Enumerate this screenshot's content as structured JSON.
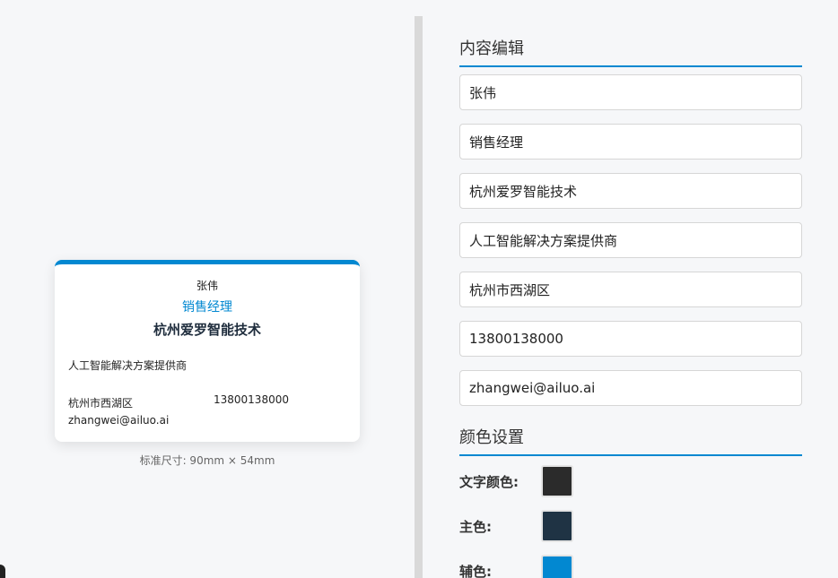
{
  "card": {
    "name": "张伟",
    "title": "销售经理",
    "company": "杭州爱罗智能技术",
    "slogan": "人工智能解决方案提供商",
    "address": "杭州市西湖区",
    "phone": "13800138000",
    "email": "zhangwei@ailuo.ai",
    "accent_color": "#0288d1"
  },
  "preview": {
    "size_note": "标准尺寸: 90mm × 54mm"
  },
  "editor": {
    "content_heading": "内容编辑",
    "fields": {
      "name": "张伟",
      "title": "销售经理",
      "company": "杭州爱罗智能技术",
      "slogan": "人工智能解决方案提供商",
      "address": "杭州市西湖区",
      "phone": "13800138000",
      "email": "zhangwei@ailuo.ai"
    },
    "color_heading": "颜色设置",
    "colors": {
      "text_label": "文字颜色:",
      "text_value": "#2b2b2b",
      "primary_label": "主色:",
      "primary_value": "#1f3344",
      "secondary_label": "辅色:",
      "secondary_value": "#0288d1"
    }
  }
}
